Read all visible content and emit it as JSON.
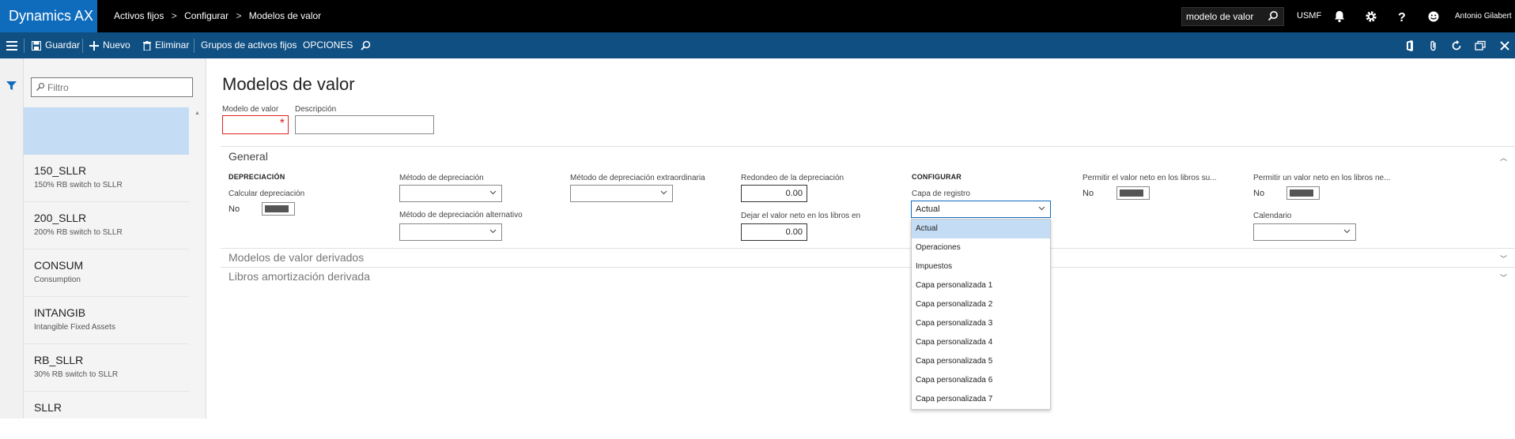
{
  "app": {
    "brand": "Dynamics AX"
  },
  "breadcrumb": {
    "items": [
      "Activos fijos",
      "Configurar",
      "Modelos de valor"
    ],
    "separator": ">"
  },
  "topbar": {
    "search_value": "modelo de valor",
    "company": "USMF",
    "user": "Antonio Gilabert",
    "icons": [
      "search-icon",
      "bell-icon",
      "gear-icon",
      "help-icon",
      "smiley-icon"
    ]
  },
  "actionbar": {
    "save": "Guardar",
    "new": "Nuevo",
    "delete": "Eliminar",
    "groups": "Grupos de activos fijos",
    "options": "OPCIONES"
  },
  "list": {
    "filter_placeholder": "Filtro",
    "items": [
      {
        "code": "150_SLLR",
        "desc": "150% RB switch to SLLR"
      },
      {
        "code": "200_SLLR",
        "desc": "200% RB switch to SLLR"
      },
      {
        "code": "CONSUM",
        "desc": "Consumption"
      },
      {
        "code": "INTANGIB",
        "desc": "Intangible Fixed Assets"
      },
      {
        "code": "RB_SLLR",
        "desc": "30% RB switch to SLLR"
      },
      {
        "code": "SLLR",
        "desc": ""
      }
    ]
  },
  "header": {
    "title": "Modelos de valor",
    "value_model_label": "Modelo de valor",
    "value_model": "",
    "description_label": "Descripción",
    "description": ""
  },
  "general": {
    "title": "General",
    "depreciation": {
      "heading": "DEPRECIACIÓN",
      "calc_label": "Calcular depreciación",
      "calc_value": "No",
      "method_label": "Método de depreciación",
      "method_value": "",
      "alt_method_label": "Método de depreciación alternativo",
      "alt_method_value": "",
      "extra_method_label": "Método de depreciación extraordinaria",
      "extra_method_value": "",
      "rounding_label": "Redondeo de la depreciación",
      "rounding_value": "0.00",
      "leave_net_label": "Dejar el valor neto en los libros en",
      "leave_net_value": "0.00"
    },
    "configure": {
      "heading": "CONFIGURAR",
      "layer_label": "Capa de registro",
      "layer_value": "Actual",
      "layer_options": [
        "Actual",
        "Operaciones",
        "Impuestos",
        "Capa personalizada 1",
        "Capa personalizada 2",
        "Capa personalizada 3",
        "Capa personalizada 4",
        "Capa personalizada 5",
        "Capa personalizada 6",
        "Capa personalizada 7"
      ],
      "allow_net_label": "Permitir el valor neto en los libros su...",
      "allow_net_value": "No",
      "allow_net2_label": "Permitir un valor neto en los libros ne...",
      "allow_net2_value": "No",
      "calendar_label": "Calendario",
      "calendar_value": ""
    }
  },
  "sections": {
    "derived_models": "Modelos de valor derivados",
    "derived_books": "Libros amortización derivada"
  }
}
